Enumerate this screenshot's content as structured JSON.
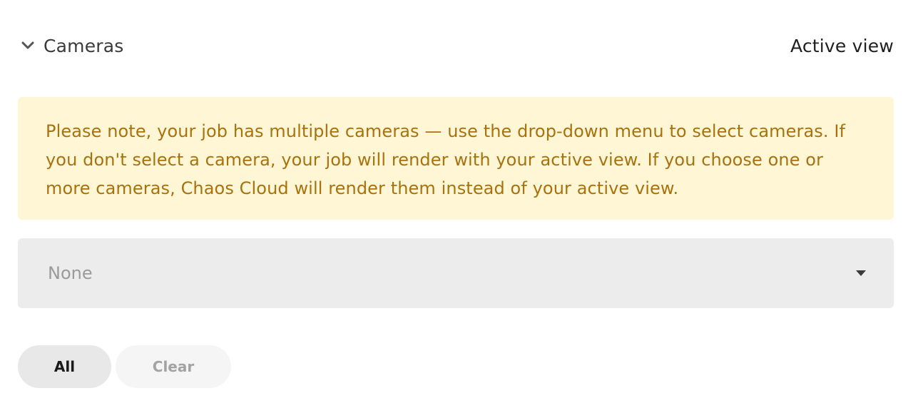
{
  "section": {
    "title": "Cameras",
    "expanded_icon": "chevron-down-icon",
    "active_view_label": "Active view"
  },
  "notice": {
    "text": "Please note, your job has multiple cameras — use the drop-down menu to select cameras. If you don't select a camera, your job will render with your active view. If you choose one or more cameras, Chaos Cloud will render them instead of your active view.",
    "background_color": "#fff6d6",
    "text_color": "#a8720c"
  },
  "camera_select": {
    "selected_value": "None",
    "caret_icon": "caret-down-icon"
  },
  "actions": {
    "all_label": "All",
    "clear_label": "Clear"
  }
}
